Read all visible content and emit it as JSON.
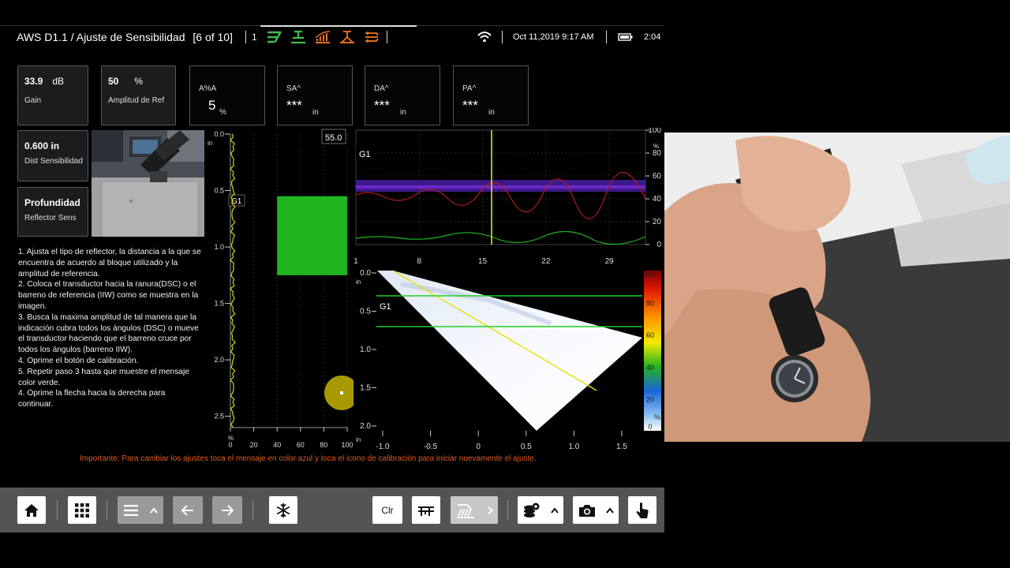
{
  "status_bar": {
    "title": "AWS D1.1  / Ajuste de Sensibilidad",
    "step": "[6 of 10]",
    "channel": "1",
    "datetime": "Oct 11,2019  9:17 AM",
    "elapsed": "2:04",
    "icons": [
      "gate-icon",
      "transducer-icon",
      "tcg-icon",
      "probe-angle-icon",
      "scan-plan-icon",
      "wifi-icon",
      "battery-icon"
    ]
  },
  "params": [
    {
      "value": "33.9",
      "unit": "dB",
      "label": "Gain"
    },
    {
      "value": "50",
      "unit": "%",
      "label": "Amplitud de Ref"
    },
    {
      "value": "0.600 in",
      "unit": "",
      "label": "Dist Sensibilidad"
    },
    {
      "value": "Profundidad",
      "unit": "",
      "label": "Reflector Sens"
    }
  ],
  "readings": [
    {
      "label": "A%A",
      "value": "5",
      "unit": "%"
    },
    {
      "label": "SA^",
      "value": "***",
      "unit": "in"
    },
    {
      "label": "DA^",
      "value": "***",
      "unit": "in"
    },
    {
      "label": "PA^",
      "value": "***",
      "unit": "in"
    }
  ],
  "ascan": {
    "unit": "in",
    "depth_ticks": [
      "0.0",
      "0.5",
      "1.0",
      "1.5",
      "2.0",
      "2.5"
    ],
    "amp_ticks": [
      "0",
      "20",
      "40",
      "60",
      "80",
      "100"
    ],
    "amp_unit": "%",
    "gate_label": "G1",
    "peak_readout": "55.0",
    "gate_from": 0.55,
    "gate_to": 1.25,
    "gate_amp_min": 40,
    "gate_amp_max": 100
  },
  "strip_chart": {
    "gate_label": "G1",
    "x_ticks": [
      "1",
      "8",
      "15",
      "22",
      "29"
    ],
    "y_ticks": [
      "100",
      "80",
      "60",
      "40",
      "20",
      "0"
    ],
    "y_unit": "%",
    "cursor_x": 16
  },
  "sscan": {
    "gate_label": "G1",
    "unit": "in",
    "depth_ticks": [
      "0.0",
      "0.5",
      "1.0",
      "1.5",
      "2.0"
    ],
    "x_ticks": [
      "-1.0",
      "-0.5",
      "0",
      "0.5",
      "1.0",
      "1.5"
    ],
    "palette_ticks": [
      "100",
      "80",
      "60",
      "40",
      "20",
      "0"
    ],
    "palette_unit": "%"
  },
  "instructions": [
    "1. Ajusta el tipo de reflector, la distancia a la que se encuentra de acuerdo al bloque utilizado y la amplitud de referencia.",
    "2. Coloca el transductor hacia la ranura(DSC) o el barreno de referencia (IIW) como se muestra en la imagen.",
    "3. Busca la maxima amplitud de tal manera que la indicación cubra todos los ángulos (DSC) o mueve el transductor haciendo que el barreno cruce por todos los ángulos (barreno IIW).",
    "4. Oprime el botón de calibración.",
    "5. Repetir paso 3 hasta que muestre el mensaje color verde.",
    "4. Oprime la flecha hacia la derecha para continuar."
  ],
  "note": "Importante: Para cambiar los ajustes toca el mensaje en color azul   y toca el icono de calibración para iniciar nuevamente el ajuste.",
  "toolbar": {
    "clear_label": "Clr",
    "icons": [
      "home-icon",
      "grid-icon",
      "menu-icon",
      "arrow-left-icon",
      "arrow-right-icon",
      "freeze-icon",
      "gate-ruler-icon",
      "calibrate-icon",
      "settings-icon",
      "camera-icon",
      "touch-icon"
    ]
  },
  "colors": {
    "accent_orange": "#e06a1f",
    "accent_green": "#3fbf4a",
    "gate_green": "#1fbf1f",
    "cursor_yellow": "#e8e000"
  }
}
